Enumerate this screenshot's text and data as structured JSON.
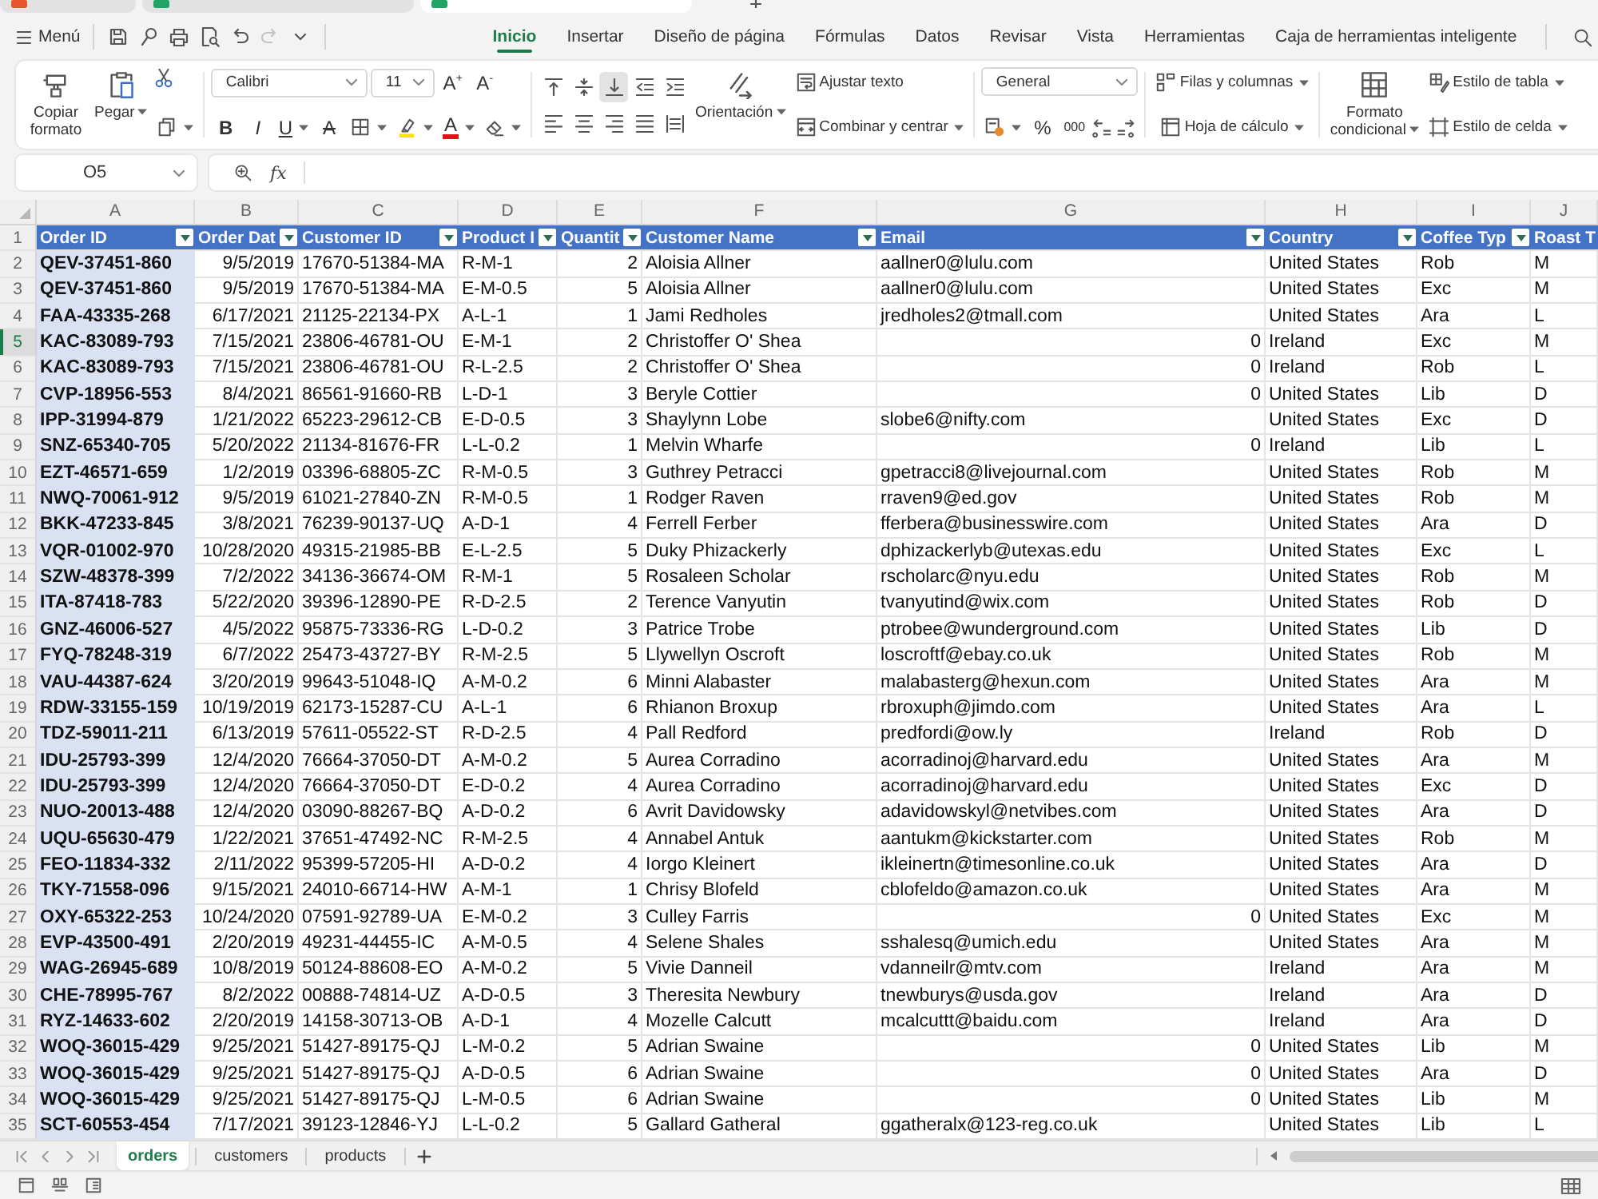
{
  "browser_tabs": [
    {
      "selected": false,
      "color": "#e8552d"
    },
    {
      "selected": false,
      "color": "#21a366"
    },
    {
      "selected": true,
      "color": "#21a366"
    }
  ],
  "menu_bar": {
    "menu_label": "Menú",
    "quick_tools": [
      {
        "kind": "save",
        "disabled": false
      },
      {
        "kind": "magnifier",
        "disabled": false
      },
      {
        "kind": "print",
        "disabled": false
      },
      {
        "kind": "preview",
        "disabled": false
      },
      {
        "kind": "undo",
        "disabled": false
      },
      {
        "kind": "redo",
        "disabled": true
      },
      {
        "kind": "more",
        "disabled": false
      }
    ]
  },
  "tabs": [
    {
      "label": "Inicio",
      "selected": true
    },
    {
      "label": "Insertar",
      "selected": false
    },
    {
      "label": "Diseño de página",
      "selected": false
    },
    {
      "label": "Fórmulas",
      "selected": false
    },
    {
      "label": "Datos",
      "selected": false
    },
    {
      "label": "Revisar",
      "selected": false
    },
    {
      "label": "Vista",
      "selected": false
    },
    {
      "label": "Herramientas",
      "selected": false
    },
    {
      "label": "Caja de herramientas inteligente",
      "selected": false
    }
  ],
  "ribbon": {
    "copy_format": "Copiar formato",
    "paste": "Pegar",
    "font_name": "Calibri",
    "font_size": "11",
    "grow_font": "A$^{+}$",
    "shrink_font": "A$^{-}$",
    "bold": "B",
    "italic": "I",
    "underline": "U",
    "strikethrough": "A",
    "font_color": "A",
    "align_tools": [
      {
        "kind": "top",
        "selected": false
      },
      {
        "kind": "middle",
        "selected": false
      },
      {
        "kind": "bottom",
        "selected": true
      },
      {
        "kind": "outdent",
        "selected": false
      },
      {
        "kind": "indent",
        "selected": false
      },
      {
        "kind": "left",
        "selected": false
      },
      {
        "kind": "center",
        "selected": false
      },
      {
        "kind": "right",
        "selected": false
      },
      {
        "kind": "justify",
        "selected": false
      },
      {
        "kind": "distributed",
        "selected": false
      }
    ],
    "orientation": "Orientación",
    "wrap_text": "Ajustar texto",
    "merge_center": "Combinar y centrar",
    "number_format": "General",
    "percent": "%",
    "thousands": "000",
    "rows_columns": "Filas y columnas",
    "worksheet": "Hoja de cálculo",
    "conditional_format": "Formato condicional",
    "table_style": "Estilo de tabla",
    "cell_style": "Estilo de celda"
  },
  "formula_bar": {
    "name_box": "O5",
    "function_label": "fx"
  },
  "sheet": {
    "header_row_number": "1",
    "columns": [
      {
        "letter": "A",
        "title": "Order ID",
        "kind": "text",
        "highlighted": true,
        "filter": true
      },
      {
        "letter": "B",
        "title": "Order Dat",
        "kind": "date",
        "highlighted": false,
        "filter": true
      },
      {
        "letter": "C",
        "title": "Customer ID",
        "kind": "text",
        "highlighted": false,
        "filter": true
      },
      {
        "letter": "D",
        "title": "Product I",
        "kind": "text",
        "highlighted": false,
        "filter": true
      },
      {
        "letter": "E",
        "title": "Quantit",
        "kind": "number",
        "highlighted": false,
        "filter": true
      },
      {
        "letter": "F",
        "title": "Customer Name",
        "kind": "text",
        "highlighted": false,
        "filter": true
      },
      {
        "letter": "G",
        "title": "Email",
        "kind": "text",
        "highlighted": false,
        "filter": true
      },
      {
        "letter": "H",
        "title": "Country",
        "kind": "text",
        "highlighted": false,
        "filter": true
      },
      {
        "letter": "I",
        "title": "Coffee Typ",
        "kind": "text",
        "highlighted": false,
        "filter": true
      },
      {
        "letter": "J",
        "title": "Roast T",
        "kind": "text",
        "highlighted": false,
        "filter": false
      }
    ],
    "rows": [
      {
        "number": "2",
        "selected": false,
        "cells": [
          "QEV-37451-860",
          "9/5/2019",
          "17670-51384-MA",
          "R-M-1",
          "2",
          "Aloisia Allner",
          "aallner0@lulu.com",
          "United States",
          "Rob",
          "M"
        ]
      },
      {
        "number": "3",
        "selected": false,
        "cells": [
          "QEV-37451-860",
          "9/5/2019",
          "17670-51384-MA",
          "E-M-0.5",
          "5",
          "Aloisia Allner",
          "aallner0@lulu.com",
          "United States",
          "Exc",
          "M"
        ]
      },
      {
        "number": "4",
        "selected": false,
        "cells": [
          "FAA-43335-268",
          "6/17/2021",
          "21125-22134-PX",
          "A-L-1",
          "1",
          "Jami Redholes",
          "jredholes2@tmall.com",
          "United States",
          "Ara",
          "L"
        ]
      },
      {
        "number": "5",
        "selected": true,
        "cells": [
          "KAC-83089-793",
          "7/15/2021",
          "23806-46781-OU",
          "E-M-1",
          "2",
          "Christoffer O' Shea",
          {
            "text": "0",
            "kind": "number"
          },
          "Ireland",
          "Exc",
          "M"
        ]
      },
      {
        "number": "6",
        "selected": false,
        "cells": [
          "KAC-83089-793",
          "7/15/2021",
          "23806-46781-OU",
          "R-L-2.5",
          "2",
          "Christoffer O' Shea",
          {
            "text": "0",
            "kind": "number"
          },
          "Ireland",
          "Rob",
          "L"
        ]
      },
      {
        "number": "7",
        "selected": false,
        "cells": [
          "CVP-18956-553",
          "8/4/2021",
          "86561-91660-RB",
          "L-D-1",
          "3",
          "Beryle Cottier",
          {
            "text": "0",
            "kind": "number"
          },
          "United States",
          "Lib",
          "D"
        ]
      },
      {
        "number": "8",
        "selected": false,
        "cells": [
          "IPP-31994-879",
          "1/21/2022",
          "65223-29612-CB",
          "E-D-0.5",
          "3",
          "Shaylynn Lobe",
          "slobe6@nifty.com",
          "United States",
          "Exc",
          "D"
        ]
      },
      {
        "number": "9",
        "selected": false,
        "cells": [
          "SNZ-65340-705",
          "5/20/2022",
          "21134-81676-FR",
          "L-L-0.2",
          "1",
          "Melvin Wharfe",
          {
            "text": "0",
            "kind": "number"
          },
          "Ireland",
          "Lib",
          "L"
        ]
      },
      {
        "number": "10",
        "selected": false,
        "cells": [
          "EZT-46571-659",
          "1/2/2019",
          "03396-68805-ZC",
          "R-M-0.5",
          "3",
          "Guthrey Petracci",
          "gpetracci8@livejournal.com",
          "United States",
          "Rob",
          "M"
        ]
      },
      {
        "number": "11",
        "selected": false,
        "cells": [
          "NWQ-70061-912",
          "9/5/2019",
          "61021-27840-ZN",
          "R-M-0.5",
          "1",
          "Rodger Raven",
          "rraven9@ed.gov",
          "United States",
          "Rob",
          "M"
        ]
      },
      {
        "number": "12",
        "selected": false,
        "cells": [
          "BKK-47233-845",
          "3/8/2021",
          "76239-90137-UQ",
          "A-D-1",
          "4",
          "Ferrell Ferber",
          "fferbera@businesswire.com",
          "United States",
          "Ara",
          "D"
        ]
      },
      {
        "number": "13",
        "selected": false,
        "cells": [
          "VQR-01002-970",
          "10/28/2020",
          "49315-21985-BB",
          "E-L-2.5",
          "5",
          "Duky Phizackerly",
          "dphizackerlyb@utexas.edu",
          "United States",
          "Exc",
          "L"
        ]
      },
      {
        "number": "14",
        "selected": false,
        "cells": [
          "SZW-48378-399",
          "7/2/2022",
          "34136-36674-OM",
          "R-M-1",
          "5",
          "Rosaleen Scholar",
          "rscholarc@nyu.edu",
          "United States",
          "Rob",
          "M"
        ]
      },
      {
        "number": "15",
        "selected": false,
        "cells": [
          "ITA-87418-783",
          "5/22/2020",
          "39396-12890-PE",
          "R-D-2.5",
          "2",
          "Terence Vanyutin",
          "tvanyutind@wix.com",
          "United States",
          "Rob",
          "D"
        ]
      },
      {
        "number": "16",
        "selected": false,
        "cells": [
          "GNZ-46006-527",
          "4/5/2022",
          "95875-73336-RG",
          "L-D-0.2",
          "3",
          "Patrice Trobe",
          "ptrobee@wunderground.com",
          "United States",
          "Lib",
          "D"
        ]
      },
      {
        "number": "17",
        "selected": false,
        "cells": [
          "FYQ-78248-319",
          "6/7/2022",
          "25473-43727-BY",
          "R-M-2.5",
          "5",
          "Llywellyn Oscroft",
          "loscroftf@ebay.co.uk",
          "United States",
          "Rob",
          "M"
        ]
      },
      {
        "number": "18",
        "selected": false,
        "cells": [
          "VAU-44387-624",
          "3/20/2019",
          "99643-51048-IQ",
          "A-M-0.2",
          "6",
          "Minni Alabaster",
          "malabasterg@hexun.com",
          "United States",
          "Ara",
          "M"
        ]
      },
      {
        "number": "19",
        "selected": false,
        "cells": [
          "RDW-33155-159",
          "10/19/2019",
          "62173-15287-CU",
          "A-L-1",
          "6",
          "Rhianon Broxup",
          "rbroxuph@jimdo.com",
          "United States",
          "Ara",
          "L"
        ]
      },
      {
        "number": "20",
        "selected": false,
        "cells": [
          "TDZ-59011-211",
          "6/13/2019",
          "57611-05522-ST",
          "R-D-2.5",
          "4",
          "Pall Redford",
          "predfordi@ow.ly",
          "Ireland",
          "Rob",
          "D"
        ]
      },
      {
        "number": "21",
        "selected": false,
        "cells": [
          "IDU-25793-399",
          "12/4/2020",
          "76664-37050-DT",
          "A-M-0.2",
          "5",
          "Aurea Corradino",
          "acorradinoj@harvard.edu",
          "United States",
          "Ara",
          "M"
        ]
      },
      {
        "number": "22",
        "selected": false,
        "cells": [
          "IDU-25793-399",
          "12/4/2020",
          "76664-37050-DT",
          "E-D-0.2",
          "4",
          "Aurea Corradino",
          "acorradinoj@harvard.edu",
          "United States",
          "Exc",
          "D"
        ]
      },
      {
        "number": "23",
        "selected": false,
        "cells": [
          "NUO-20013-488",
          "12/4/2020",
          "03090-88267-BQ",
          "A-D-0.2",
          "6",
          "Avrit Davidowsky",
          "adavidowskyl@netvibes.com",
          "United States",
          "Ara",
          "D"
        ]
      },
      {
        "number": "24",
        "selected": false,
        "cells": [
          "UQU-65630-479",
          "1/22/2021",
          "37651-47492-NC",
          "R-M-2.5",
          "4",
          "Annabel Antuk",
          "aantukm@kickstarter.com",
          "United States",
          "Rob",
          "M"
        ]
      },
      {
        "number": "25",
        "selected": false,
        "cells": [
          "FEO-11834-332",
          "2/11/2022",
          "95399-57205-HI",
          "A-D-0.2",
          "4",
          "Iorgo Kleinert",
          "ikleinertn@timesonline.co.uk",
          "United States",
          "Ara",
          "D"
        ]
      },
      {
        "number": "26",
        "selected": false,
        "cells": [
          "TKY-71558-096",
          "9/15/2021",
          "24010-66714-HW",
          "A-M-1",
          "1",
          "Chrisy Blofeld",
          "cblofeldo@amazon.co.uk",
          "United States",
          "Ara",
          "M"
        ]
      },
      {
        "number": "27",
        "selected": false,
        "cells": [
          "OXY-65322-253",
          "10/24/2020",
          "07591-92789-UA",
          "E-M-0.2",
          "3",
          "Culley Farris",
          {
            "text": "0",
            "kind": "number"
          },
          "United States",
          "Exc",
          "M"
        ]
      },
      {
        "number": "28",
        "selected": false,
        "cells": [
          "EVP-43500-491",
          "2/20/2019",
          "49231-44455-IC",
          "A-M-0.5",
          "4",
          "Selene Shales",
          "sshalesq@umich.edu",
          "United States",
          "Ara",
          "M"
        ]
      },
      {
        "number": "29",
        "selected": false,
        "cells": [
          "WAG-26945-689",
          "10/8/2019",
          "50124-88608-EO",
          "A-M-0.2",
          "5",
          "Vivie Danneil",
          "vdanneilr@mtv.com",
          "Ireland",
          "Ara",
          "M"
        ]
      },
      {
        "number": "30",
        "selected": false,
        "cells": [
          "CHE-78995-767",
          "8/2/2022",
          "00888-74814-UZ",
          "A-D-0.5",
          "3",
          "Theresita Newbury",
          "tnewburys@usda.gov",
          "Ireland",
          "Ara",
          "D"
        ]
      },
      {
        "number": "31",
        "selected": false,
        "cells": [
          "RYZ-14633-602",
          "2/20/2019",
          "14158-30713-OB",
          "A-D-1",
          "4",
          "Mozelle Calcutt",
          "mcalcuttt@baidu.com",
          "Ireland",
          "Ara",
          "D"
        ]
      },
      {
        "number": "32",
        "selected": false,
        "cells": [
          "WOQ-36015-429",
          "9/25/2021",
          "51427-89175-QJ",
          "L-M-0.2",
          "5",
          "Adrian Swaine",
          {
            "text": "0",
            "kind": "number"
          },
          "United States",
          "Lib",
          "M"
        ]
      },
      {
        "number": "33",
        "selected": false,
        "cells": [
          "WOQ-36015-429",
          "9/25/2021",
          "51427-89175-QJ",
          "A-D-0.5",
          "6",
          "Adrian Swaine",
          {
            "text": "0",
            "kind": "number"
          },
          "United States",
          "Ara",
          "D"
        ]
      },
      {
        "number": "34",
        "selected": false,
        "cells": [
          "WOQ-36015-429",
          "9/25/2021",
          "51427-89175-QJ",
          "L-M-0.5",
          "6",
          "Adrian Swaine",
          {
            "text": "0",
            "kind": "number"
          },
          "United States",
          "Lib",
          "M"
        ]
      },
      {
        "number": "35",
        "selected": false,
        "cells": [
          "SCT-60553-454",
          "7/17/2021",
          "39123-12846-YJ",
          "L-L-0.2",
          "5",
          "Gallard Gatheral",
          "ggatheralx@123-reg.co.uk",
          "United States",
          "Lib",
          "L"
        ]
      }
    ]
  },
  "sheet_tabs": [
    {
      "label": "orders",
      "selected": true
    },
    {
      "label": "customers",
      "selected": false
    },
    {
      "label": "products",
      "selected": false
    }
  ]
}
